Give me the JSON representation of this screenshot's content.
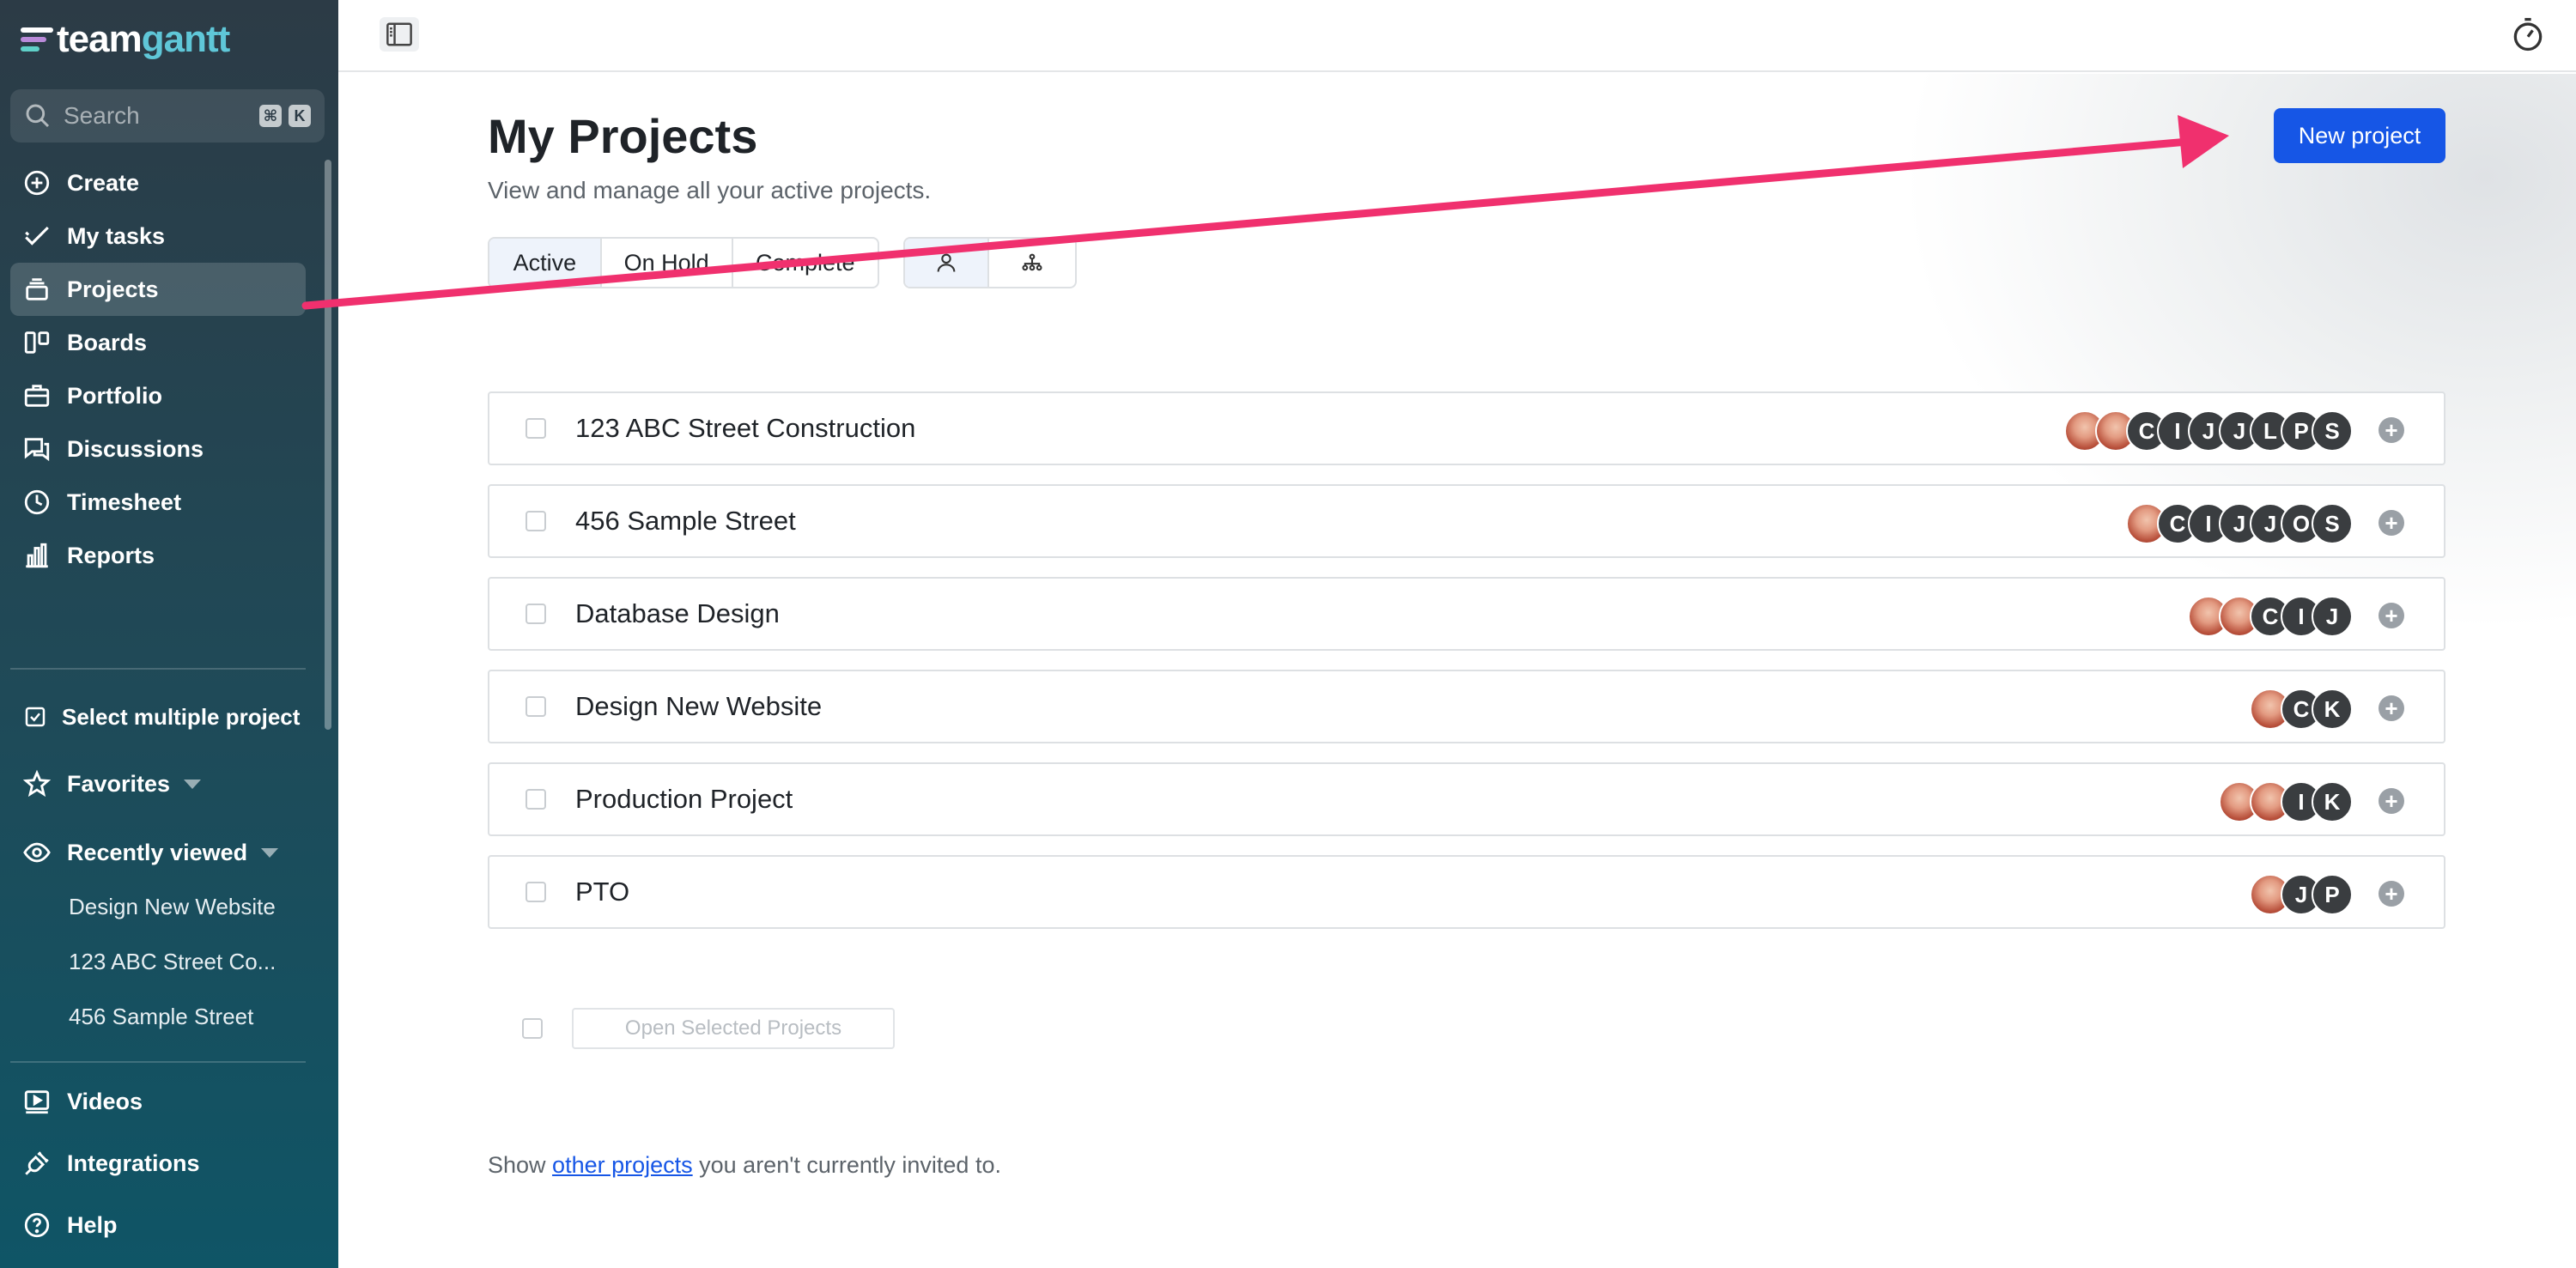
{
  "brand": {
    "part1": "team",
    "part2": "gantt"
  },
  "search": {
    "placeholder": "Search",
    "key1": "⌘",
    "key2": "K"
  },
  "sidebar": {
    "items": [
      {
        "label": "Create",
        "icon": "plus-circle-icon"
      },
      {
        "label": "My tasks",
        "icon": "checkmark-icon"
      },
      {
        "label": "Projects",
        "icon": "stack-icon",
        "active": true
      },
      {
        "label": "Boards",
        "icon": "board-icon"
      },
      {
        "label": "Portfolio",
        "icon": "briefcase-icon"
      },
      {
        "label": "Discussions",
        "icon": "chat-icon"
      },
      {
        "label": "Timesheet",
        "icon": "clock-icon"
      },
      {
        "label": "Reports",
        "icon": "bar-chart-icon"
      }
    ],
    "select_multiple": "Select multiple project",
    "favorites": "Favorites",
    "recently_viewed": "Recently viewed",
    "recent": [
      "Design New Website",
      "123 ABC Street Co...",
      "456 Sample Street"
    ],
    "bottom": [
      {
        "label": "Videos",
        "icon": "video-icon"
      },
      {
        "label": "Integrations",
        "icon": "plug-icon"
      },
      {
        "label": "Help",
        "icon": "help-icon"
      }
    ]
  },
  "main": {
    "title": "My Projects",
    "subtitle": "View and manage all your active projects.",
    "new_project": "New project",
    "status_tabs": [
      "Active",
      "On Hold",
      "Complete"
    ],
    "selected_status": "Active",
    "projects": [
      {
        "name": "123 ABC Street Construction",
        "avatars": [
          "photo",
          "photo",
          "C",
          "I",
          "J",
          "J",
          "L",
          "P",
          "S"
        ]
      },
      {
        "name": "456 Sample Street",
        "avatars": [
          "photo",
          "C",
          "I",
          "J",
          "J",
          "O",
          "S"
        ]
      },
      {
        "name": "Database Design",
        "avatars": [
          "photo",
          "photo",
          "C",
          "I",
          "J"
        ]
      },
      {
        "name": "Design New Website",
        "avatars": [
          "photo",
          "C",
          "K"
        ]
      },
      {
        "name": "Production Project",
        "avatars": [
          "photo",
          "photo",
          "I",
          "K"
        ]
      },
      {
        "name": "PTO",
        "avatars": [
          "photo",
          "J",
          "P"
        ]
      }
    ],
    "open_selected": "Open Selected Projects",
    "footer_prefix": "Show ",
    "footer_link": "other projects",
    "footer_suffix": " you aren't currently invited to."
  },
  "colors": {
    "accent": "#1656e6",
    "annotation_arrow": "#f0306e",
    "sidebar_top": "#2c3b46",
    "sidebar_bottom": "#0f5566"
  }
}
